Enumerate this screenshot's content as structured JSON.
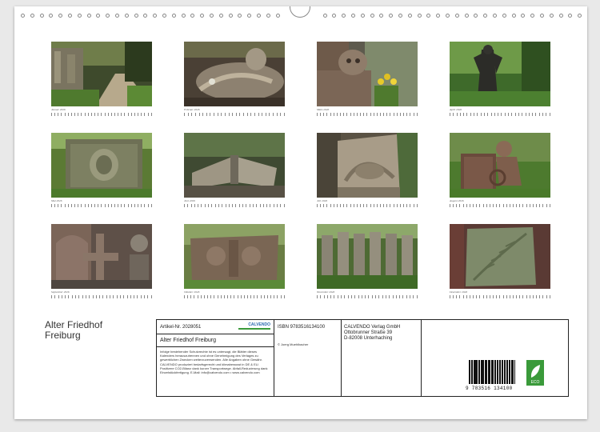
{
  "months": [
    {
      "label": "Januar 2026",
      "days": 31
    },
    {
      "label": "Februar 2026",
      "days": 28
    },
    {
      "label": "März 2026",
      "days": 31
    },
    {
      "label": "April 2026",
      "days": 30
    },
    {
      "label": "Mai 2026",
      "days": 31
    },
    {
      "label": "Juni 2026",
      "days": 30
    },
    {
      "label": "Juli 2026",
      "days": 31
    },
    {
      "label": "August 2026",
      "days": 31
    },
    {
      "label": "September 2026",
      "days": 30
    },
    {
      "label": "Oktober 2026",
      "days": 31
    },
    {
      "label": "November 2026",
      "days": 30
    },
    {
      "label": "Dezember 2026",
      "days": 31
    }
  ],
  "calendar_title_line1": "Alter Friedhof",
  "calendar_title_line2": "Freiburg",
  "info": {
    "article_no": "Artikel-Nr. 2028051",
    "calvendo_logo": "CALVENDO",
    "product_title": "Alter Friedhof Freiburg",
    "legal_text": "Infolge bestehender Schutzrechte ist es untersagt, die Blätter dieses Kalenders herauszutrennen und ohne Genehmigung des Verlages zu gewerblichen Zwecken weiterzuverwenden. Alle Angaben ohne Gewähr. CALVENDO produziert bedarfsgerecht und klimabewusst in DE & EU. Positivere CO2-Bilanz dank kurzer Transportwege. Abfall-Reduzierung dank Einzelstückfertigung. E-Mail: info@calvendo.com • www.calvendo.com",
    "isbn": "ISBN 9783516134100",
    "copyright": "© Joerg Muehlbacher",
    "publisher_line1": "CALVENDO Verlag GmbH",
    "publisher_line2": "Ottobrunner Straße 39",
    "publisher_line3": "D-82008 Unterhaching",
    "barcode_number": "9 783516 134100",
    "eco_label": "ECO"
  }
}
